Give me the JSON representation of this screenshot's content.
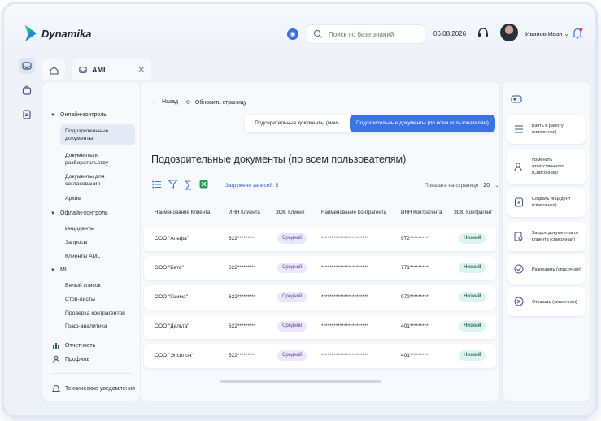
{
  "app": {
    "name": "Dynamika",
    "date": "06.08.2026",
    "user": "Иванов Иван"
  },
  "search": {
    "placeholder": "Поиск по базе знаний"
  },
  "tabs": {
    "active": "AML"
  },
  "sidenav": {
    "online_section": "Онлайн-контроль",
    "online_items": [
      "Подозрительные документы",
      "Документы к разбирательству",
      "Документы для согласования",
      "Архив"
    ],
    "offline_section": "Офлайн-контроль",
    "offline_items": [
      "Инциденты",
      "Запросы",
      "Клиенты AML"
    ],
    "ml_section": "ML",
    "ml_items": [
      "Белый список",
      "Стоп-листы",
      "Проверка контрагентов",
      "Граф-аналитика"
    ],
    "reports": "Отчетность",
    "profile": "Профиль",
    "notifications": "Технические уведомления"
  },
  "main": {
    "back": "Назад",
    "refresh": "Обновить страницу",
    "seg_option1": "Подозрительные документы (мои)",
    "seg_option2": "Подозрительные документы (по всем пользователям)",
    "title": "Подозрительные документы (по всем пользователям)",
    "loaded": "Загружено записей: 5",
    "per_page_label": "Показать на странице",
    "per_page_value": "20"
  },
  "table": {
    "columns": [
      "Наименование Клиента",
      "ИНН Клиента",
      "ЗСК. Клиент",
      "Наименование Контрагента",
      "ИНН Контрагента",
      "ЗСК. Контрагент"
    ],
    "rows": [
      [
        "ООО \"Альфа\"",
        "622*********",
        "Средний",
        "***********************",
        "972*********",
        "Низкий"
      ],
      [
        "ООО \"Бета\"",
        "622*********",
        "Средний",
        "***********************",
        "771*********",
        "Низкий"
      ],
      [
        "ООО \"Гамма\"",
        "622*********",
        "Средний",
        "***********************",
        "972*********",
        "Низкий"
      ],
      [
        "ООО \"Дельта\"",
        "622*********",
        "Средний",
        "***********************",
        "401*********",
        "Низкий"
      ],
      [
        "ООО \"Эпсилон\"",
        "622*********",
        "Средний",
        "***********************",
        "401*********",
        "Низкий"
      ]
    ]
  },
  "actions": [
    "Взять в работу (списочная)",
    "Изменить ответственного (Списочная)",
    "Создать инцидент (списочная)",
    "Запрос документов от клиента (списочная)",
    "Разрешить (списочная)",
    "Отказать (списочная)"
  ],
  "colors": {
    "accent": "#3b73e6",
    "badge_mid_bg": "#ece6fb",
    "badge_low_bg": "#dff3ee",
    "background": "#eef2f8"
  }
}
